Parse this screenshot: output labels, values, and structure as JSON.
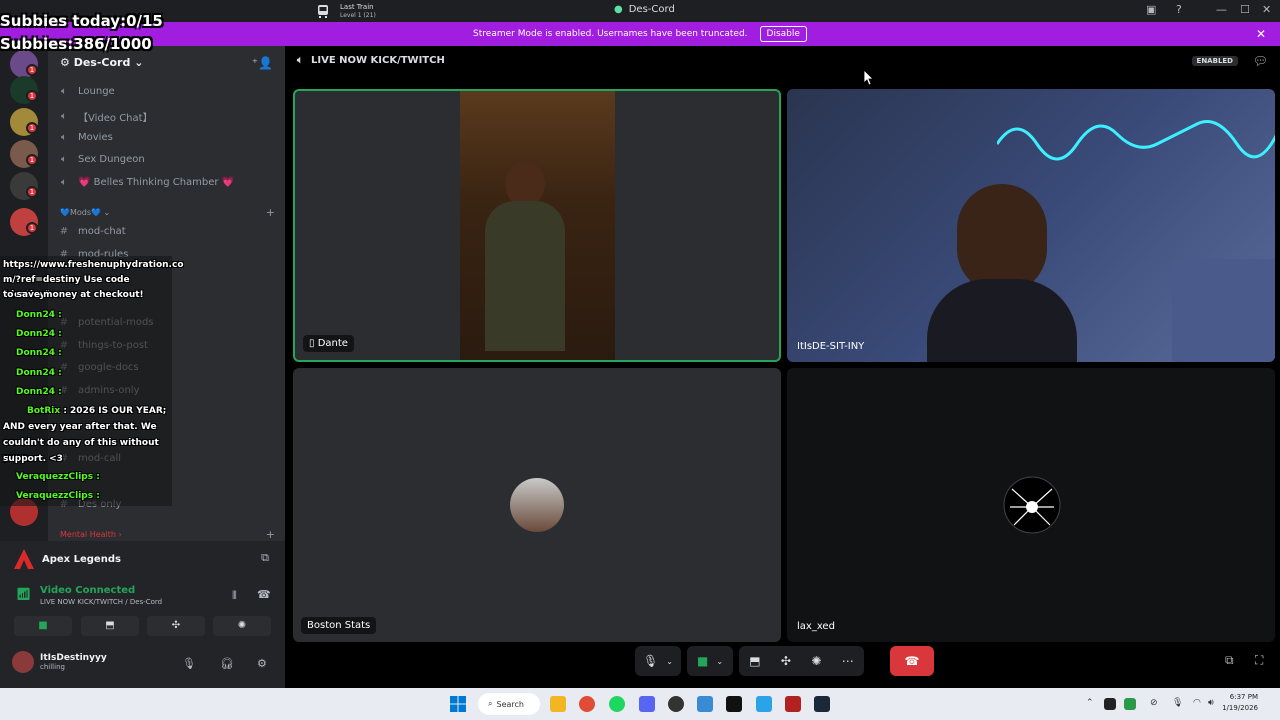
{
  "titlebar": {
    "game_title": "Last Train",
    "game_sub": "Level 1 (21)",
    "app_title": "Des-Cord",
    "controls": [
      "—",
      "☐",
      "✕"
    ]
  },
  "banner": {
    "text": "Streamer Mode is enabled. Usernames have been truncated.",
    "button": "Disable"
  },
  "overlay_top": {
    "line1": "Subbies today:0/15",
    "line2": "Subbies:386/1000"
  },
  "server": {
    "name": "Des-Cord",
    "channels": [
      {
        "name": "Lounge",
        "type": "voice"
      },
      {
        "name": "【Video Chat】",
        "type": "voice"
      },
      {
        "name": "Movies",
        "type": "voice"
      },
      {
        "name": "Sex Dungeon",
        "type": "voice"
      },
      {
        "name": "💗 Belles Thinking Chamber 💗",
        "type": "voice"
      }
    ],
    "mods_category": "💙Mods💙",
    "mod_channels": [
      "mod-chat",
      "mod-rules",
      "potential-mods",
      "things-to-post",
      "google-docs",
      "admins-only",
      "mod-call",
      "Des only"
    ],
    "mental_category": "Mental Health"
  },
  "chat_overlay": {
    "ad_line1": "https://www.freshenuphydration.co",
    "ad_line2": "m/?ref=destiny Use code \"destiny\"",
    "ad_line3": "to save money at checkout!",
    "messages": [
      {
        "user": "Donn24 :",
        "text": ""
      },
      {
        "user": "Donn24 :",
        "text": ""
      },
      {
        "user": "Donn24 :",
        "text": ""
      },
      {
        "user": "Donn24 :",
        "text": ""
      },
      {
        "user": "Donn24 :",
        "text": ""
      }
    ],
    "botrix_user": "BotRix",
    "botrix_1": ": 2026 IS OUR YEAR;",
    "botrix_2": "AND every year after that. We",
    "botrix_3": "couldn't do any of this without your",
    "botrix_4": "support. <3",
    "clip_user_1": "VeraquezzClips :",
    "clip_user_2": "VeraquezzClips :"
  },
  "voice_panel": {
    "game": "Apex Legends",
    "status": "Video Connected",
    "sub": "LIVE NOW KICK/TWITCH / Des-Cord",
    "username": "ItIsDestinyyy",
    "user_status": "chilling"
  },
  "main": {
    "channel": "LIVE NOW KICK/TWITCH",
    "enabled": "ENABLED",
    "tiles": [
      {
        "name": "Dante"
      },
      {
        "name": "ItIsDE-SIT-INY"
      },
      {
        "name": "Boston Stats"
      },
      {
        "name": "lax_xed"
      }
    ]
  },
  "taskbar": {
    "search": "Search",
    "time": "6:37 PM",
    "date": "1/19/2026"
  }
}
